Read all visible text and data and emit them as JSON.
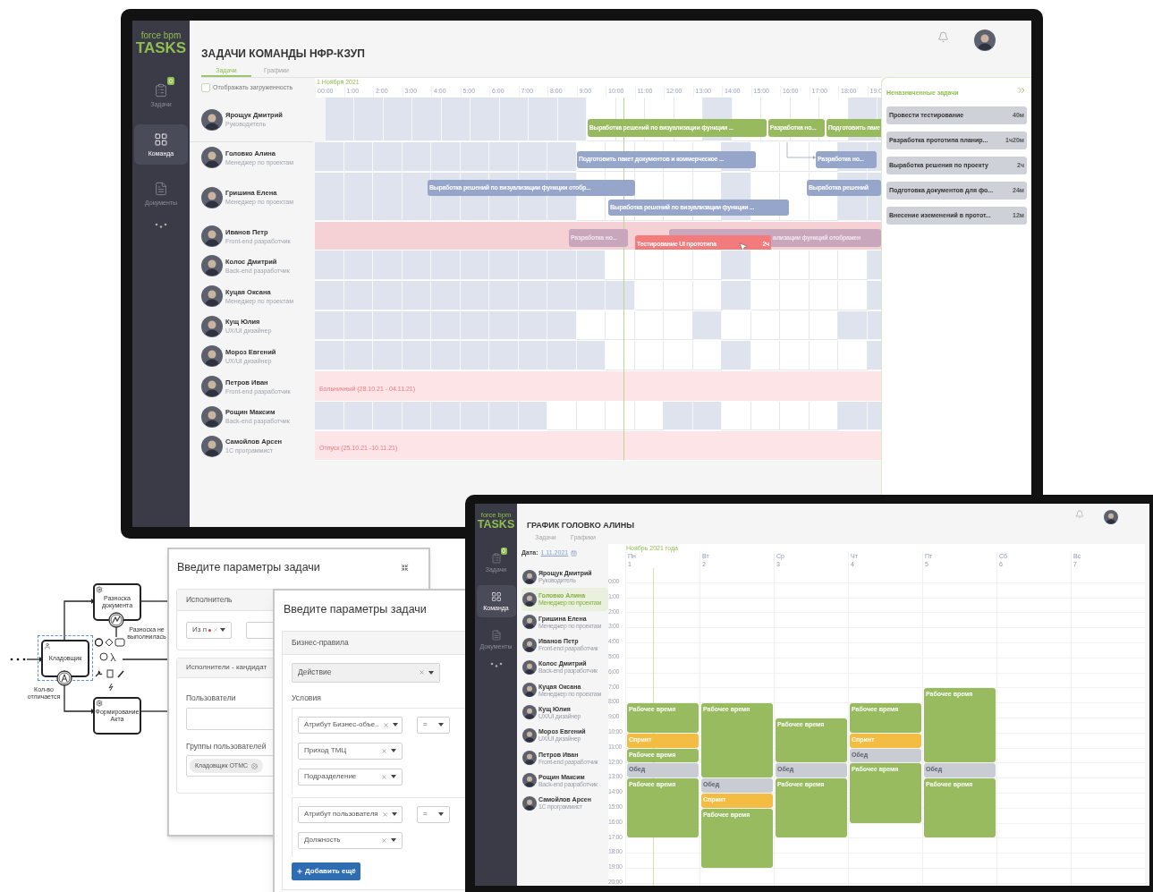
{
  "team_window": {
    "logo": {
      "top": "force bpm",
      "bottom": "TASKS"
    },
    "nav": [
      {
        "kind": "tasks",
        "label": "Задачи",
        "badge": "0",
        "selected": false
      },
      {
        "kind": "team",
        "label": "Команда",
        "selected": true
      },
      {
        "kind": "docs",
        "label": "Документы",
        "selected": false
      }
    ],
    "title": "ЗАДАЧИ КОМАНДЫ НФР-КЗУП",
    "tabs": [
      {
        "label": "Задачи",
        "selected": true
      },
      {
        "label": "Графики",
        "selected": false
      }
    ],
    "show_load": {
      "label": "Отображать загруженность",
      "checked": false
    },
    "date": "1 Ноября 2021",
    "hours": [
      "00:00",
      "1:00",
      "2:00",
      "3:00",
      "4:00",
      "5:00",
      "6:00",
      "7:00",
      "8:00",
      "9:00",
      "10:00",
      "11:00",
      "12:00",
      "13:00",
      "14:00",
      "15:00",
      "16:00",
      "17:00",
      "18:00",
      "19:0"
    ],
    "rows": [
      {
        "name": "Ярощук Дмитрий",
        "role": "Руководитель",
        "kind": "schedule",
        "highlighted": false,
        "free": [
          false,
          false,
          false,
          false,
          false,
          false,
          false,
          false,
          false,
          true,
          true,
          true,
          true,
          false,
          true,
          true,
          true,
          true,
          false,
          false
        ],
        "bars": [
          {
            "text": "Выработка решений по визуализации функции ...",
            "kind": "planned"
          },
          {
            "text": "Разработка но...",
            "kind": "planned"
          },
          {
            "text": "Подготовить паке",
            "kind": "planned"
          }
        ]
      },
      {
        "name": "Головко Алина",
        "role": "Менеджер по проектам",
        "kind": "schedule",
        "highlighted": false,
        "free": [
          false,
          false,
          false,
          false,
          false,
          false,
          false,
          false,
          false,
          true,
          true,
          true,
          true,
          true,
          false,
          true,
          true,
          true,
          false,
          false
        ],
        "bars": [
          {
            "text": "Подготовить пакет документов и коммерческое ...",
            "kind": "assigned"
          },
          {
            "text": "Разработка но...",
            "kind": "assigned"
          }
        ]
      },
      {
        "name": "Гришина Елена",
        "role": "Менеджер по проектам",
        "kind": "schedule",
        "highlighted": false,
        "free": [
          false,
          false,
          false,
          false,
          false,
          false,
          false,
          false,
          false,
          true,
          true,
          true,
          true,
          true,
          false,
          true,
          true,
          true,
          false,
          false
        ],
        "bars": [
          {
            "text": "Выработка решений по визуализации функции отобр...",
            "kind": "assigned"
          },
          {
            "text": "Выработка решений",
            "kind": "assigned"
          },
          {
            "text": "Выработка решений по визуализации функции ...",
            "kind": "assigned"
          }
        ]
      },
      {
        "name": "Иванов Петр",
        "role": "Front-end разработчик",
        "kind": "schedule",
        "highlighted": true,
        "bars": [
          {
            "text": "Разработка но...",
            "kind": "faded"
          },
          {
            "text": "ализации функций отображен",
            "kind": "faded"
          },
          {
            "text": "Тестирование UI прототипа",
            "duration": "2ч",
            "kind": "active"
          }
        ]
      },
      {
        "name": "Колос Дмитрий",
        "role": "Back-end разработчик",
        "kind": "schedule",
        "highlighted": false,
        "free": [
          false,
          false,
          false,
          false,
          false,
          false,
          false,
          false,
          false,
          false,
          true,
          true,
          true,
          true,
          false,
          true,
          true,
          true,
          true,
          false
        ],
        "bars": []
      },
      {
        "name": "Куцая Оксана",
        "role": "Менеджер по проектам",
        "kind": "schedule",
        "highlighted": false,
        "free": [
          false,
          false,
          false,
          false,
          false,
          false,
          false,
          false,
          false,
          false,
          false,
          true,
          true,
          true,
          false,
          true,
          true,
          true,
          true,
          false
        ],
        "bars": []
      },
      {
        "name": "Кущ Юлия",
        "role": "UX/UI дизайнер",
        "kind": "schedule",
        "highlighted": false,
        "free": [
          false,
          false,
          false,
          false,
          false,
          false,
          false,
          false,
          false,
          true,
          true,
          true,
          true,
          false,
          true,
          true,
          true,
          true,
          false,
          false
        ],
        "bars": []
      },
      {
        "name": "Мороз Евгений",
        "role": "UX/UI дизайнер",
        "kind": "schedule",
        "highlighted": false,
        "free": [
          false,
          false,
          false,
          false,
          false,
          false,
          false,
          false,
          false,
          false,
          true,
          true,
          true,
          true,
          false,
          true,
          true,
          true,
          true,
          false
        ],
        "bars": []
      },
      {
        "name": "Петров Иван",
        "role": "Front-end разработчик",
        "kind": "absence",
        "highlighted": false,
        "note": "Больничный (28.10.21 - 04.11.21)"
      },
      {
        "name": "Рощин Максим",
        "role": "Back-end разработчик",
        "kind": "schedule",
        "highlighted": false,
        "free": [
          false,
          false,
          false,
          false,
          false,
          false,
          false,
          false,
          true,
          true,
          true,
          true,
          false,
          false,
          true,
          true,
          true,
          true,
          false,
          false
        ],
        "bars": []
      },
      {
        "name": "Самойлов Арсен",
        "role": "1С программист",
        "kind": "absence",
        "highlighted": false,
        "note": "Отпуск (25.10.21 -10.11.21)"
      }
    ],
    "unassigned": {
      "title": "Неназначенные задачи",
      "items": [
        {
          "name": "Провести тестирование",
          "duration": "40м"
        },
        {
          "name": "Разработка прототипа планир...",
          "duration": "1ч20м"
        },
        {
          "name": "Выработка решения по проекту",
          "duration": "2ч"
        },
        {
          "name": "Подготовка документов для фо...",
          "duration": "24м"
        },
        {
          "name": "Внесение иземенений в протот...",
          "duration": "12м"
        }
      ]
    }
  },
  "process_diagram": {
    "tasks": [
      {
        "label": "Кладовщик",
        "kind": "user",
        "selected": true
      },
      {
        "label": "Разноска документа",
        "kind": "service",
        "selected": false
      },
      {
        "label": "Формирование Акта",
        "kind": "service",
        "selected": false
      }
    ],
    "event_labels": [
      "Кол-во отличается",
      "Разноска не выполнилась"
    ]
  },
  "task_dialog_back": {
    "title": "Введите параметры задачи",
    "assignee_header": "Исполнитель",
    "assignee_select": "Из п",
    "candidates_header": "Исполнители - кандидат",
    "users_label": "Пользователи",
    "groups_label": "Группы пользователей",
    "groups": [
      "Кладовщик ОТМС"
    ]
  },
  "task_dialog_front": {
    "title": "Введите параметры задачи",
    "rules_header": "Бизнес-правила",
    "action": "Действие",
    "conditions_label": "Условия",
    "condition_groups": [
      {
        "fields": [
          "Атрибут Бизнес-объе..",
          "Приход ТМЦ",
          "Подразделение"
        ],
        "operator": "="
      },
      {
        "fields": [
          "Атрибут пользователя",
          "Должность"
        ],
        "operator": "="
      }
    ],
    "add_button": "Добавить ещё"
  },
  "schedule_window": {
    "logo": {
      "top": "force bpm",
      "bottom": "TASKS"
    },
    "nav": [
      {
        "kind": "tasks",
        "label": "Задачи",
        "badge": "0",
        "selected": false
      },
      {
        "kind": "team",
        "label": "Команда",
        "selected": true
      },
      {
        "kind": "docs",
        "label": "Документы",
        "selected": false
      }
    ],
    "title": "ГРАФИК ГОЛОВКО АЛИНЫ",
    "tabs": [
      {
        "label": "Задачи",
        "selected": false
      },
      {
        "label": "Графики",
        "selected": false
      }
    ],
    "date_label": "Дата:",
    "date": "1.11.2021",
    "people": [
      {
        "name": "Ярощук Дмитрий",
        "role": "Руководитель",
        "selected": false
      },
      {
        "name": "Головко Алина",
        "role": "Менеджер по проектам",
        "selected": true
      },
      {
        "name": "Гришина Елена",
        "role": "Менеджер по проектам",
        "selected": false
      },
      {
        "name": "Иванов Петр",
        "role": "Front-end разработчик",
        "selected": false
      },
      {
        "name": "Колос Дмитрий",
        "role": "Back-end разработчик",
        "selected": false
      },
      {
        "name": "Куцая Оксана",
        "role": "Менеджер по проектам",
        "selected": false
      },
      {
        "name": "Кущ Юлия",
        "role": "UX/UI дизайнер",
        "selected": false
      },
      {
        "name": "Мороз Евгений",
        "role": "UX/UI дизайнер",
        "selected": false
      },
      {
        "name": "Петров Иван",
        "role": "Front-end разработчик",
        "selected": false
      },
      {
        "name": "Рощин Максим",
        "role": "Back-end разработчик",
        "selected": false
      },
      {
        "name": "Самойлов Арсен",
        "role": "1С программист",
        "selected": false
      }
    ],
    "month": "Ноябрь 2021 года",
    "hours": [
      "0:00",
      "1:00",
      "2:00",
      "3:00",
      "4:00",
      "5:00",
      "6:00",
      "7:00",
      "8:00",
      "9:00",
      "10:00",
      "11:00",
      "12:00",
      "13:00",
      "14:00",
      "15:00",
      "16:00",
      "17:00",
      "18:00",
      "19:00",
      "20:00"
    ],
    "days": [
      {
        "name": "Пн",
        "date": "1",
        "events": [
          {
            "label": "Рабочее время",
            "kind": "work"
          },
          {
            "label": "Спринт",
            "kind": "sprint"
          },
          {
            "label": "Рабочее время",
            "kind": "work"
          },
          {
            "label": "Обед",
            "kind": "lunch"
          },
          {
            "label": "Рабочее время",
            "kind": "work"
          }
        ]
      },
      {
        "name": "Вт",
        "date": "2",
        "events": [
          {
            "label": "Рабочее время",
            "kind": "work"
          },
          {
            "label": "Обед",
            "kind": "lunch"
          },
          {
            "label": "Спринт",
            "kind": "sprint"
          },
          {
            "label": "Рабочее время",
            "kind": "work"
          }
        ]
      },
      {
        "name": "Ср",
        "date": "3",
        "events": [
          {
            "label": "Рабочее время",
            "kind": "work"
          },
          {
            "label": "Обед",
            "kind": "lunch"
          },
          {
            "label": "Рабочее время",
            "kind": "work"
          }
        ]
      },
      {
        "name": "Чт",
        "date": "4",
        "events": [
          {
            "label": "Рабочее время",
            "kind": "work"
          },
          {
            "label": "Спринт",
            "kind": "sprint"
          },
          {
            "label": "Обед",
            "kind": "lunch"
          },
          {
            "label": "Рабочее время",
            "kind": "work"
          }
        ]
      },
      {
        "name": "Пт",
        "date": "5",
        "events": [
          {
            "label": "Рабочее время",
            "kind": "work"
          },
          {
            "label": "Обед",
            "kind": "lunch"
          },
          {
            "label": "Рабочее время",
            "kind": "work"
          }
        ]
      },
      {
        "name": "Сб",
        "date": "6"
      },
      {
        "name": "Вс",
        "date": "7"
      }
    ]
  }
}
